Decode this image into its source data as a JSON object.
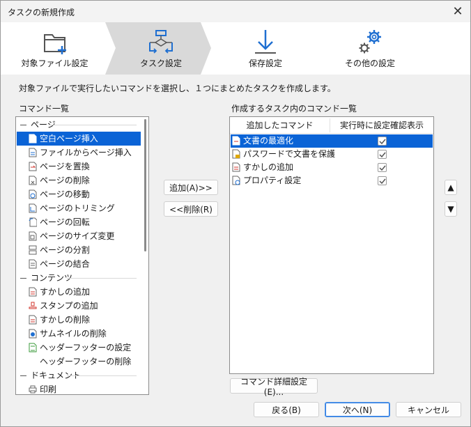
{
  "window": {
    "title": "タスクの新規作成",
    "close_glyph": "✕"
  },
  "steps": [
    {
      "label": "対象ファイル設定",
      "icon": "folder-add-icon"
    },
    {
      "label": "タスク設定",
      "icon": "task-flow-icon",
      "active": true
    },
    {
      "label": "保存設定",
      "icon": "download-arrow-icon"
    },
    {
      "label": "その他の設定",
      "icon": "gears-icon"
    }
  ],
  "instruction": "対象ファイルで実行したいコマンドを選択し、１つにまとめたタスクを作成します。",
  "command_list": {
    "label": "コマンド一覧",
    "groups": [
      {
        "name": "ページ",
        "items": [
          "空白ページ挿入",
          "ファイルからページ挿入",
          "ページを置換",
          "ページの削除",
          "ページの移動",
          "ページのトリミング",
          "ページの回転",
          "ページのサイズ変更",
          "ページの分割",
          "ページの結合"
        ]
      },
      {
        "name": "コンテンツ",
        "items": [
          "すかしの追加",
          "スタンプの追加",
          "すかしの削除",
          "サムネイルの削除",
          "ヘッダーフッターの設定",
          "ヘッダーフッターの削除"
        ]
      },
      {
        "name": "ドキュメント",
        "items": [
          "印刷"
        ]
      }
    ],
    "selected": "空白ページ挿入"
  },
  "buttons": {
    "add": "追加(A)>>",
    "remove": "<<削除(R)",
    "detail": "コマンド詳細設定(E)...",
    "back": "戻る(B)",
    "next": "次へ(N)",
    "cancel": "キャンセル",
    "up_glyph": "▲",
    "down_glyph": "▼"
  },
  "task_list": {
    "label": "作成するタスク内のコマンド一覧",
    "col_command": "追加したコマンド",
    "col_confirm": "実行時に設定確認表示",
    "rows": [
      {
        "name": "文書の最適化",
        "confirm": true,
        "selected": true
      },
      {
        "name": "パスワードで文書を保護",
        "confirm": true
      },
      {
        "name": "すかしの追加",
        "confirm": true
      },
      {
        "name": "プロパティ設定",
        "confirm": true
      }
    ]
  },
  "colors": {
    "accent": "#0a63d6",
    "step_active": "#d9d9d9",
    "icon_blue": "#1f6fd1"
  }
}
